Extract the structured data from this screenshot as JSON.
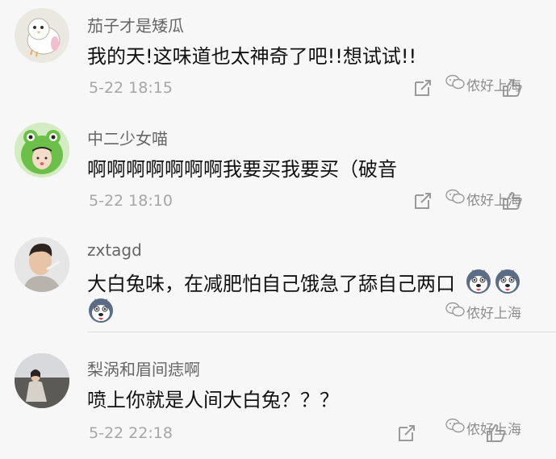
{
  "comments": [
    {
      "username": "茄子才是矮瓜",
      "content": "我的天!这味道也太神奇了吧!!想试试!!",
      "time": "5-22 18:15",
      "avatar_icon": "bird-avatar"
    },
    {
      "username": "中二少女喵",
      "content": "啊啊啊啊啊啊啊我要买我要买（破音",
      "time": "5-22 18:10",
      "avatar_icon": "frog-hat-avatar"
    },
    {
      "username": "zxtagd",
      "content": "大白兔味，在减肥怕自己饿急了舔自己两口",
      "time": "",
      "avatar_icon": "man-photo-avatar"
    },
    {
      "username": "梨涡和眉间痣啊",
      "content": "喷上你就是人间大白兔？？？",
      "time": "5-22 22:18",
      "avatar_icon": "woman-photo-avatar"
    }
  ],
  "watermark_text": "侬好上海",
  "emoji_icon": "husky-emoji",
  "icons": {
    "reply": "reply-icon",
    "like": "thumbs-up-icon",
    "watermark_logo": "wechat-logo-icon"
  },
  "colors": {
    "background": "#f7f7f7",
    "username": "#666666",
    "content": "#111111",
    "meta": "#a6a6a6"
  }
}
